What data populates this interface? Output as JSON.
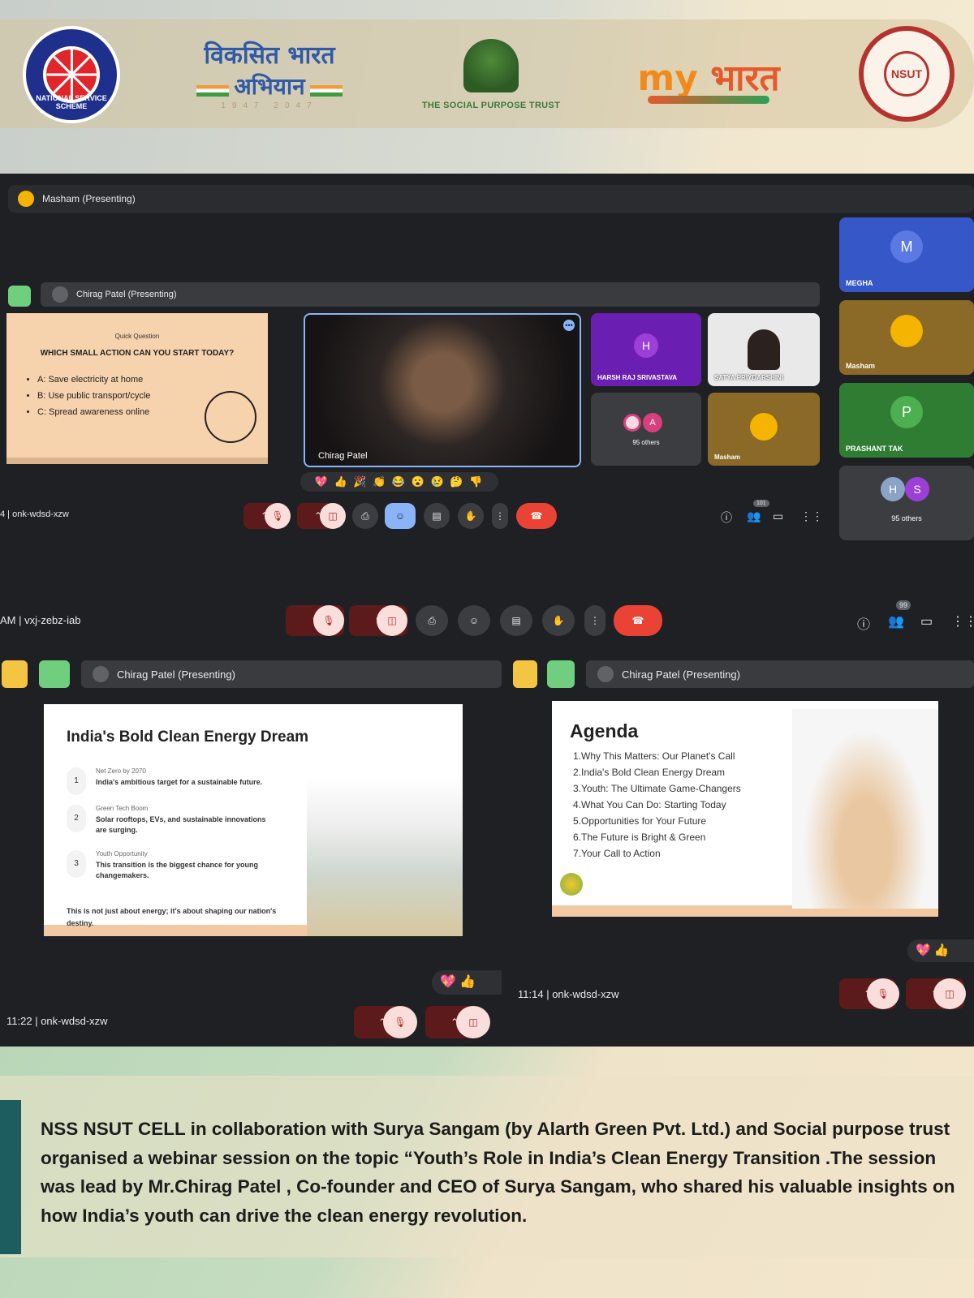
{
  "header": {
    "nss_logo_text": "NATIONAL SERVICE SCHEME",
    "vba_line1": "विकसित भारत",
    "vba_line2": "अभियान",
    "vba_years": "1947 2047",
    "spt_title": "THE SOCIAL PURPOSE TRUST",
    "mybharat_my": "my",
    "mybharat_text": "भारत",
    "nsut_logo_text": "NSUT"
  },
  "meeting": {
    "presenting_label": "Masham (Presenting)",
    "inner1": {
      "presenting_label": "Chirag Patel (Presenting)",
      "slide": {
        "kicker": "Quick Question",
        "title": "WHICH SMALL ACTION CAN YOU START TODAY?",
        "options": [
          "A: Save electricity at home",
          "B: Use public transport/cycle",
          "C: Spread awareness online"
        ]
      },
      "video_name": "Chirag Patel",
      "tiles": {
        "harsh_initial": "H",
        "harsh_name": "HARSH RAJ SRIVASTAVA",
        "satya_name": "SATYA PRIYDARSHINI",
        "others_initial": "A",
        "others_label": "95 others",
        "masham_name": "Masham"
      },
      "reactions": "💖 👍 🎉 👏 😂 😮 😢 🤔 👎",
      "code_prefix": "4",
      "meeting_code": "onk-wdsd-xzw",
      "participant_count": "101"
    },
    "side_tiles": {
      "megha_initial": "M",
      "megha_name": "MEGHA",
      "masham_name": "Masham",
      "prashant_initial": "P",
      "prashant_name": "PRASHANT TAK",
      "others_initials": [
        "H",
        "S"
      ],
      "others_label": "95 others"
    },
    "outer_bar": {
      "time_suffix": "AM",
      "meeting_code": "vxj-zebz-iab",
      "participant_count": "99"
    },
    "bottom_left": {
      "presenting_label": "Chirag Patel (Presenting)",
      "slide": {
        "title": "India's Bold Clean Energy Dream",
        "items": [
          {
            "num": "1",
            "head": "Net Zero by 2070",
            "text": "India's ambitious target for a sustainable future."
          },
          {
            "num": "2",
            "head": "Green Tech Boom",
            "text": "Solar rooftops, EVs, and sustainable innovations are surging."
          },
          {
            "num": "3",
            "head": "Youth Opportunity",
            "text": "This transition is the biggest chance for young changemakers."
          }
        ],
        "footer": "This is not just about energy; it's about shaping our nation's destiny."
      },
      "reactions": "💖 👍",
      "time": "11:22",
      "meeting_code": "onk-wdsd-xzw"
    },
    "bottom_right": {
      "presenting_label": "Chirag Patel (Presenting)",
      "slide": {
        "title": "Agenda",
        "items": [
          "1.Why This Matters: Our Planet's Call",
          "2.India's Bold Clean Energy Dream",
          "3.Youth: The Ultimate Game-Changers",
          "4.What You Can Do: Starting Today",
          "5.Opportunities for Your Future",
          "6.The Future is Bright & Green",
          "7.Your Call to Action"
        ]
      },
      "reactions": "💖 👍",
      "time": "11:14",
      "meeting_code": "onk-wdsd-xzw"
    }
  },
  "caption": "NSS NSUT CELL in collaboration with Surya Sangam (by Alarth Green Pvt. Ltd.) and Social purpose trust organised a webinar session on the topic “Youth’s Role in India’s Clean Energy Transition .The session was lead by Mr.Chirag Patel , Co-founder and CEO of Surya Sangam, who shared his valuable insights on how India’s youth can drive the clean energy revolution.",
  "colors": {
    "meet_bg": "#1f2023",
    "accent_blue": "#8ab4f8",
    "end_call_red": "#ea4335",
    "caption_accent": "#1d5d5f"
  }
}
